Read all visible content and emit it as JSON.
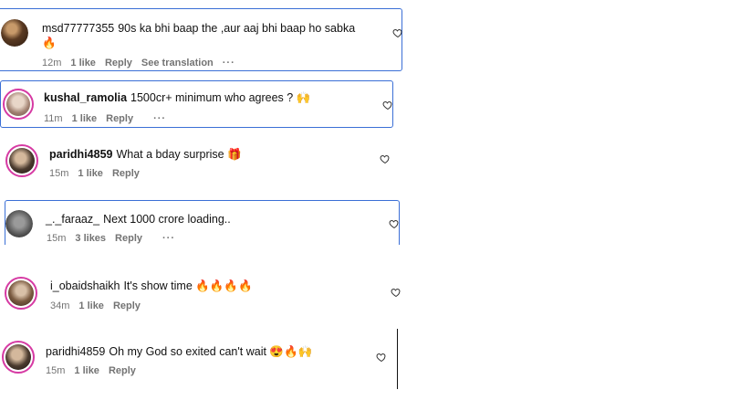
{
  "comments": [
    {
      "username": "msd77777355",
      "text": "90s ka bhi baap the ,aur aaj bhi baap ho sabka 🔥",
      "time": "12m",
      "likes": "1 like",
      "reply": "Reply",
      "extra": "See translation",
      "more": "···"
    },
    {
      "username": "kushal_ramolia",
      "text": "1500cr+ minimum who agrees ? 🙌",
      "time": "11m",
      "likes": "1 like",
      "reply": "Reply",
      "more": "···"
    },
    {
      "username": "paridhi4859",
      "text": "What a bday surprise 🎁",
      "time": "15m",
      "likes": "1 like",
      "reply": "Reply"
    },
    {
      "username": "_._faraaz_",
      "text": "Next 1000 crore loading..",
      "time": "15m",
      "likes": "3 likes",
      "reply": "Reply",
      "more": "···"
    },
    {
      "username": "i_obaidshaikh",
      "text": "It's show time 🔥🔥🔥🔥",
      "time": "34m",
      "likes": "1 like",
      "reply": "Reply"
    },
    {
      "username": "paridhi4859",
      "text": "Oh my God so exited can't wait 😍🔥🙌",
      "time": "15m",
      "likes": "1 like",
      "reply": "Reply"
    }
  ],
  "colors": {
    "selection_border": "#3b6fd6",
    "story_ring": "#d63aa3",
    "meta_text": "#737373"
  },
  "icons": {
    "like": "heart-icon",
    "more": "more-options-icon"
  }
}
